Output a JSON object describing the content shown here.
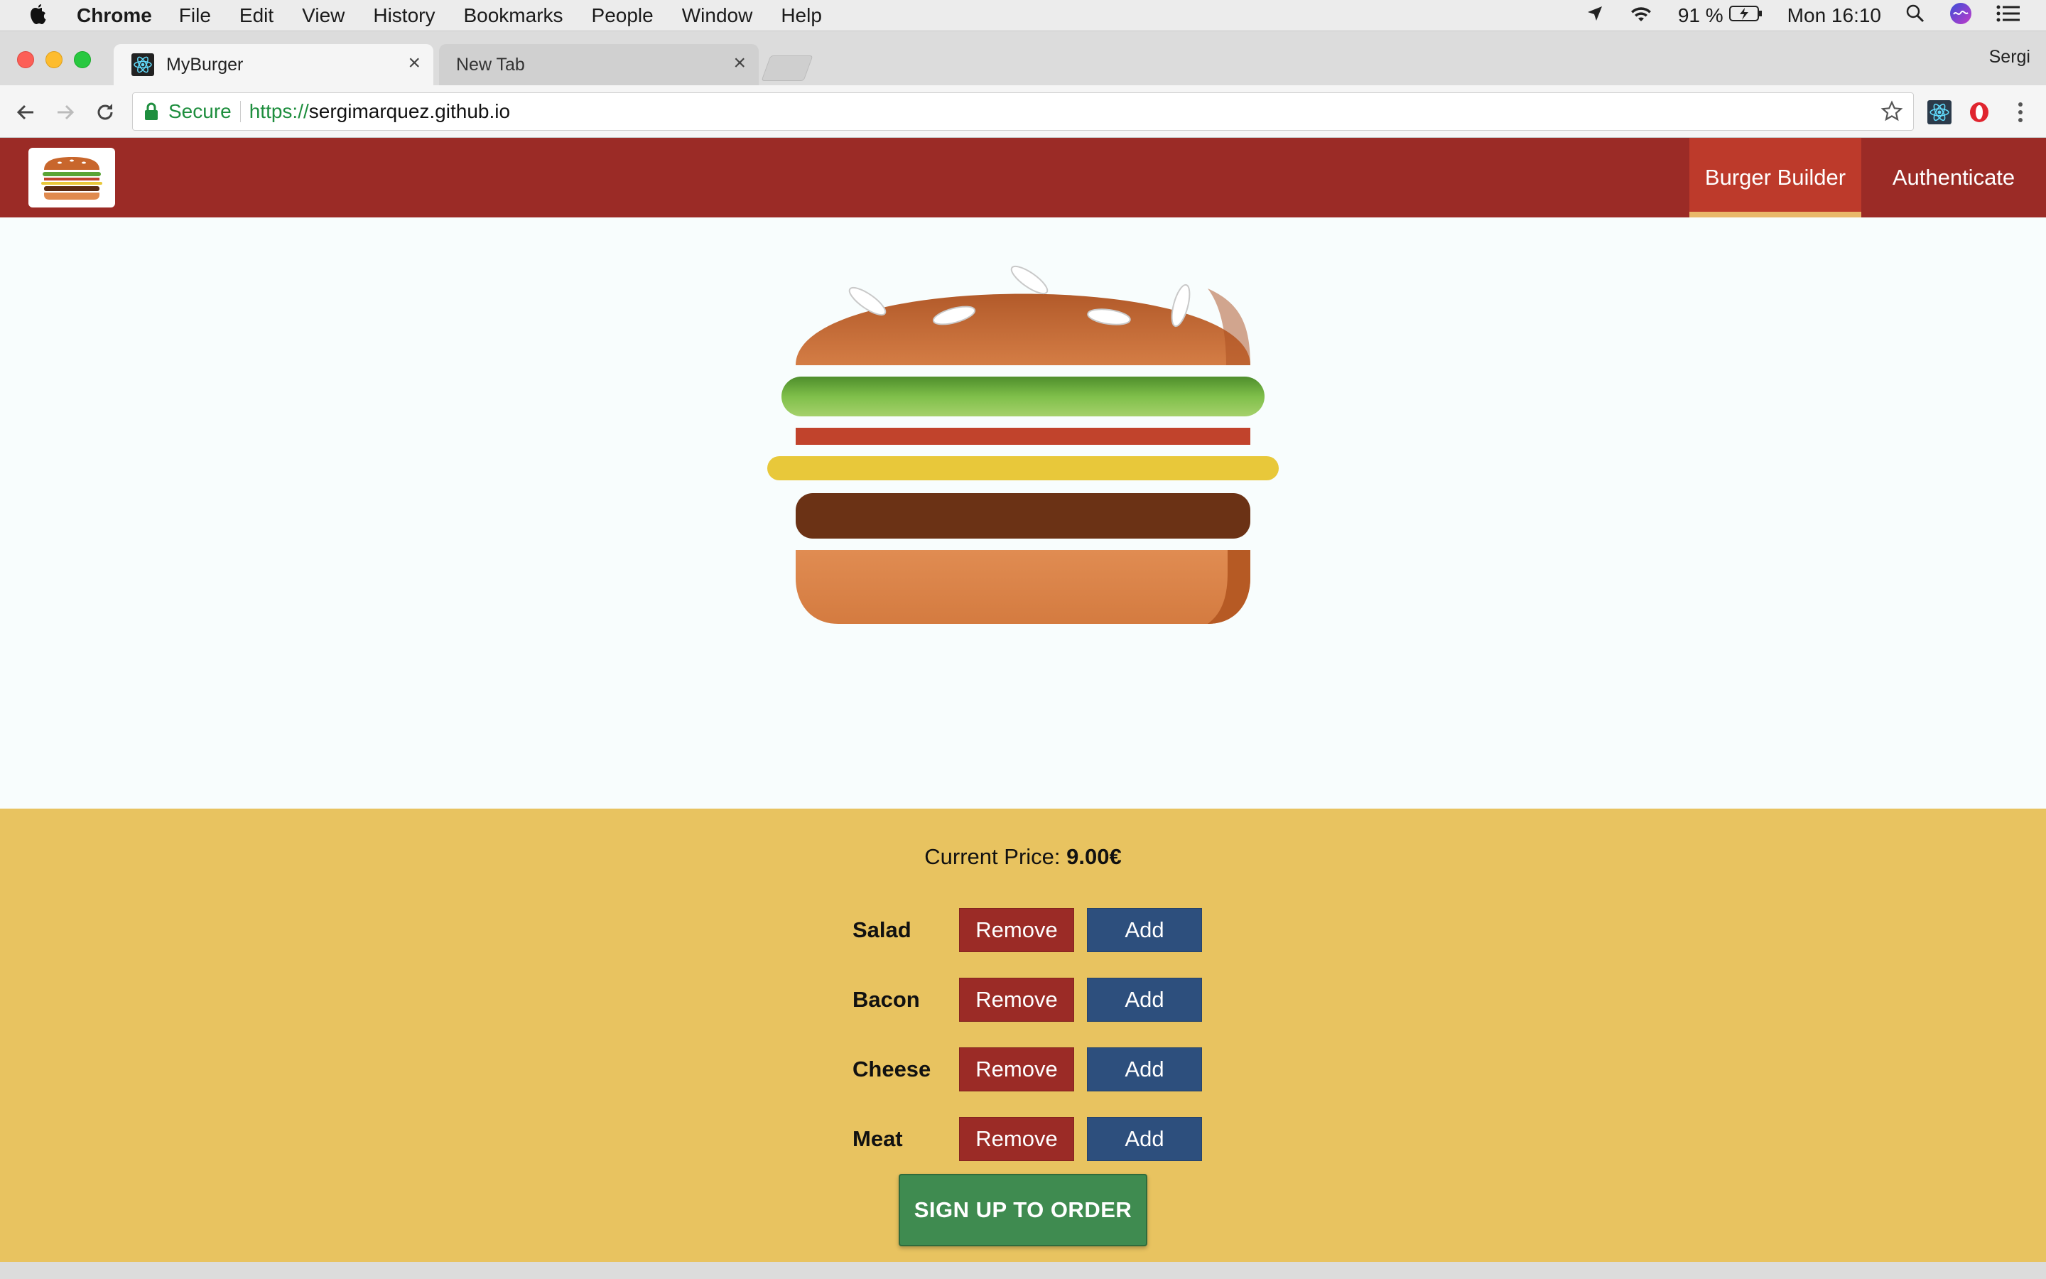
{
  "menubar": {
    "app_name": "Chrome",
    "items": [
      "File",
      "Edit",
      "View",
      "History",
      "Bookmarks",
      "People",
      "Window",
      "Help"
    ],
    "battery": "91 %",
    "clock": "Mon 16:10"
  },
  "browser": {
    "tabs": [
      {
        "title": "MyBurger",
        "active": true
      },
      {
        "title": "New Tab",
        "active": false
      }
    ],
    "profile": "Sergi",
    "address": {
      "secure_label": "Secure",
      "scheme": "https://",
      "host": "sergimarquez.github.io"
    }
  },
  "header": {
    "nav": [
      {
        "label": "Burger Builder",
        "active": true
      },
      {
        "label": "Authenticate",
        "active": false
      }
    ],
    "colors": {
      "toolbar": "#9b2b26",
      "active_tab": "#bd3a2b",
      "active_underline": "#e9b86a"
    }
  },
  "burger": {
    "ingredients": [
      "bread-top",
      "salad",
      "bacon",
      "cheese",
      "meat",
      "bread-bottom"
    ]
  },
  "controls": {
    "price_label": "Current Price:",
    "price_value": "9.00€",
    "rows": [
      {
        "label": "Salad",
        "remove": "Remove",
        "add": "Add"
      },
      {
        "label": "Bacon",
        "remove": "Remove",
        "add": "Add"
      },
      {
        "label": "Cheese",
        "remove": "Remove",
        "add": "Add"
      },
      {
        "label": "Meat",
        "remove": "Remove",
        "add": "Add"
      }
    ],
    "order_button": "SIGN UP TO ORDER",
    "colors": {
      "panel": "#e8c360",
      "remove": "#9b2b26",
      "add": "#2d4f7d",
      "order": "#3f8b50"
    }
  }
}
